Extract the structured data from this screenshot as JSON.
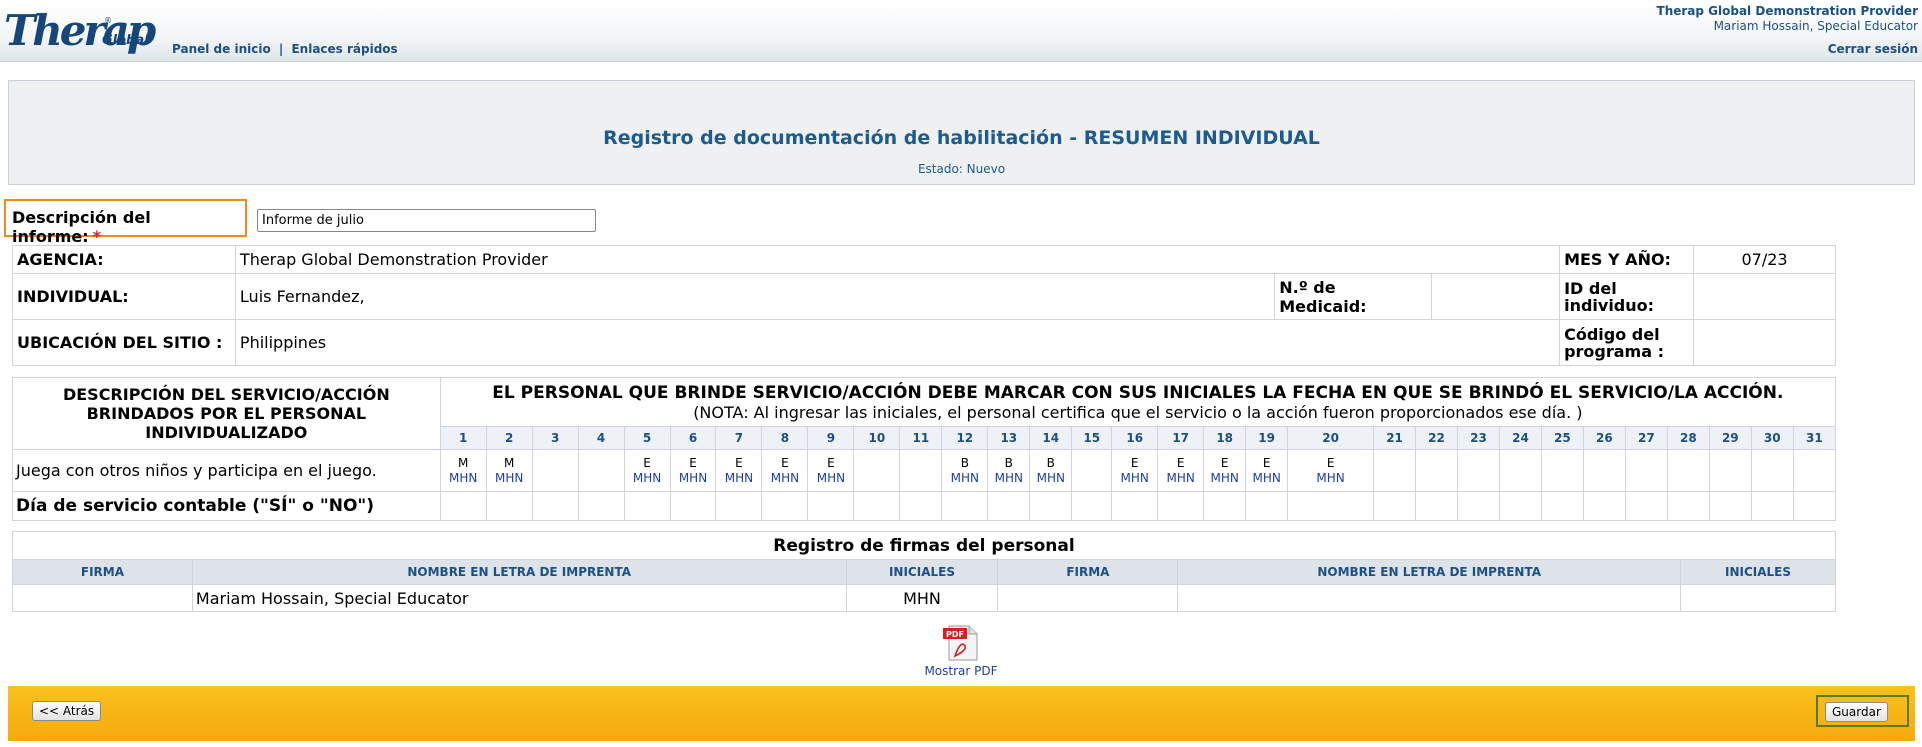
{
  "header": {
    "logo_text": "Therap",
    "logo_sub": "Global",
    "nav": {
      "home": "Panel de inicio",
      "sep": "|",
      "quick_links": "Enlaces rápidos"
    },
    "provider": "Therap Global Demonstration Provider",
    "user": "Mariam Hossain, Special Educator",
    "logout": "Cerrar sesión"
  },
  "page": {
    "title": "Registro de documentación de habilitación - RESUMEN INDIVIDUAL",
    "status": "Estado: Nuevo"
  },
  "report": {
    "desc_label": "Descripción del informe:",
    "required": "*",
    "desc_value": "Informe de julio"
  },
  "info": {
    "agency_label": "AGENCIA:",
    "agency": "Therap Global Demonstration Provider",
    "month_label": "MES Y AÑO:",
    "month": "07/23",
    "individual_label": "INDIVIDUAL:",
    "individual": "Luis  Fernandez,",
    "medicaid_label": "N.º de Medicaid:",
    "medicaid": "",
    "id_label": "ID del individuo:",
    "id": "",
    "site_label": "UBICACIÓN DEL SITIO :",
    "site": "Philippines",
    "program_label": "Código del programa :",
    "program": ""
  },
  "service": {
    "desc_header": "DESCRIPCIÓN DEL SERVICIO/ACCIÓN BRINDADOS POR EL PERSONAL INDIVIDUALIZADO",
    "note_title": "EL PERSONAL QUE BRINDE SERVICIO/ACCIÓN DEBE MARCAR CON SUS INICIALES LA FECHA EN QUE SE BRINDÓ EL SERVICIO/LA ACCIÓN.",
    "note_sub": "(NOTA: Al ingresar las iniciales, el personal certifica que el servicio o la acción fueron proporcionados ese día. )",
    "days": [
      "1",
      "2",
      "3",
      "4",
      "5",
      "6",
      "7",
      "8",
      "9",
      "10",
      "11",
      "12",
      "13",
      "14",
      "15",
      "16",
      "17",
      "18",
      "19",
      "20",
      "21",
      "22",
      "23",
      "24",
      "25",
      "26",
      "27",
      "28",
      "29",
      "30",
      "31"
    ],
    "row_label": "Juega con otros niños y participa en el juego.",
    "marks": [
      "M",
      "M",
      "",
      "",
      "E",
      "E",
      "E",
      "E",
      "E",
      "",
      "",
      "B",
      "B",
      "B",
      "",
      "E",
      "E",
      "E",
      "E",
      "E",
      "",
      "",
      "",
      "",
      "",
      "",
      "",
      "",
      "",
      "",
      ""
    ],
    "initials": [
      "MHN",
      "MHN",
      "",
      "",
      "MHN",
      "MHN",
      "MHN",
      "MHN",
      "MHN",
      "",
      "",
      "MHN",
      "MHN",
      "MHN",
      "",
      "MHN",
      "MHN",
      "MHN",
      "MHN",
      "MHN",
      "",
      "",
      "",
      "",
      "",
      "",
      "",
      "",
      "",
      "",
      ""
    ],
    "count_label": "Día de servicio contable (\"SÍ\" o \"NO\")"
  },
  "signatures": {
    "caption": "Registro de firmas del personal",
    "col_sig": "FIRMA",
    "col_name": "NOMBRE EN LETRA DE IMPRENTA",
    "col_ini": "INICIALES",
    "row": {
      "sig1": "",
      "name1": "Mariam Hossain, Special Educator",
      "ini1": "MHN",
      "sig2": "",
      "name2": "",
      "ini2": ""
    }
  },
  "pdf": {
    "icon_text": "PDF",
    "label": "Mostrar PDF"
  },
  "footer": {
    "back": "<< Atrás",
    "save": "Guardar"
  }
}
